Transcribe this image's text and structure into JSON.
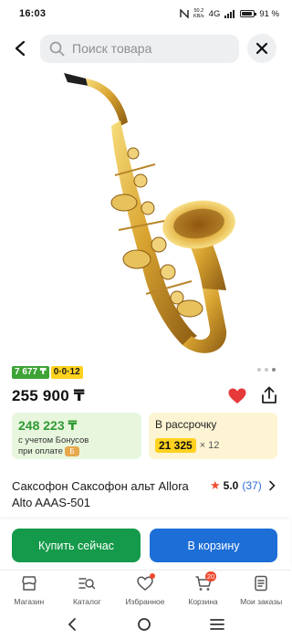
{
  "status_bar": {
    "time": "16:03",
    "net_speed_value": "50.2",
    "net_speed_unit": "KB/s",
    "network": "4G",
    "battery": "91 %"
  },
  "search": {
    "placeholder": "Поиск товара"
  },
  "gallery": {
    "active_index": 2,
    "total": 3
  },
  "badges": {
    "bonus_price": "7 677 ₸",
    "installment_plan": "0·0·12"
  },
  "product": {
    "price": "255 900 ₸",
    "name": "Саксофон Саксофон альт Allora Alto AAAS-501",
    "rating": "5.0",
    "reviews": "(37)"
  },
  "bonus_card": {
    "amount": "248 223 ₸",
    "line1": "с учетом Бонусов",
    "line2": "при оплате"
  },
  "installment_card": {
    "title": "В рассрочку",
    "monthly": "21 325",
    "months": "× 12"
  },
  "actions": {
    "buy_now": "Купить сейчас",
    "add_to_cart": "В корзину"
  },
  "nav": {
    "items": [
      {
        "label": "Магазин"
      },
      {
        "label": "Каталог"
      },
      {
        "label": "Избранное"
      },
      {
        "label": "Корзина",
        "badge": "20"
      },
      {
        "label": "Мои заказы"
      }
    ]
  },
  "colors": {
    "accent_green": "#149a4a",
    "accent_blue": "#1d6ed7",
    "badge_yellow": "#ffd21f",
    "heart_red": "#e63a3a"
  }
}
